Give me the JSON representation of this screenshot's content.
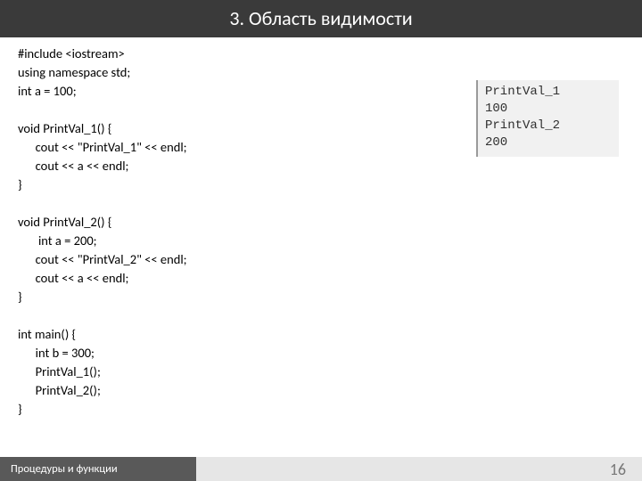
{
  "slide": {
    "title": "3. Область видимости",
    "code": "#include <iostream>\nusing namespace std;\nint a = 100;\n\nvoid PrintVal_1() {\n      cout << \"PrintVal_1\" << endl;\n      cout << a << endl;\n}\n\nvoid PrintVal_2() {\n       int a = 200;\n      cout << \"PrintVal_2\" << endl;\n      cout << a << endl;\n}\n\nint main() {\n      int b = 300;\n      PrintVal_1();\n      PrintVal_2();\n}",
    "output": "PrintVal_1\n100\nPrintVal_2\n200"
  },
  "footer": {
    "label": "Процедуры и функции",
    "page": "16"
  }
}
